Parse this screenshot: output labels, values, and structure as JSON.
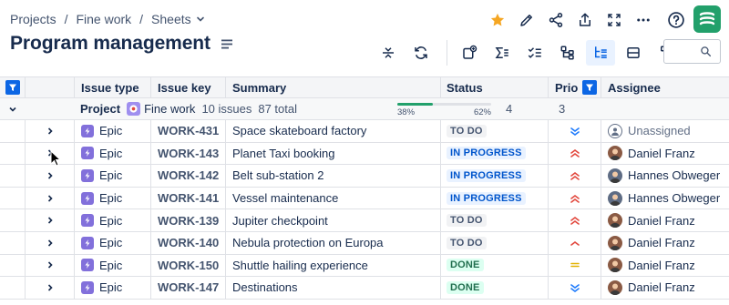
{
  "breadcrumb": {
    "items": [
      "Projects",
      "Fine work",
      "Sheets"
    ]
  },
  "page_title": "Program management",
  "search": {
    "value": "",
    "placeholder": ""
  },
  "columns": {
    "issue_type": "Issue type",
    "issue_key": "Issue key",
    "summary": "Summary",
    "status": "Status",
    "priority": "Prio",
    "assignee": "Assignee"
  },
  "group": {
    "label": "Project",
    "project_name": "Fine work",
    "issue_count": "10 issues",
    "total": "87 total",
    "progress_done": 38,
    "progress_left_label": "38%",
    "progress_right_label": "62%",
    "priority_count": "4",
    "assignee_count": "3"
  },
  "rows": [
    {
      "type": "Epic",
      "key": "WORK-431",
      "summary": "Space skateboard factory",
      "status": "TO DO",
      "status_kind": "todo",
      "priority": "low",
      "assignee": "Unassigned",
      "assignee_kind": "unassigned"
    },
    {
      "type": "Epic",
      "key": "WORK-143",
      "summary": "Planet Taxi booking",
      "status": "IN PROGRESS",
      "status_kind": "progress",
      "priority": "highest",
      "assignee": "Daniel Franz",
      "assignee_kind": "df"
    },
    {
      "type": "Epic",
      "key": "WORK-142",
      "summary": "Belt sub-station 2",
      "status": "IN PROGRESS",
      "status_kind": "progress",
      "priority": "highest",
      "assignee": "Hannes Obweger",
      "assignee_kind": "ho"
    },
    {
      "type": "Epic",
      "key": "WORK-141",
      "summary": "Vessel maintenance",
      "status": "IN PROGRESS",
      "status_kind": "progress",
      "priority": "highest",
      "assignee": "Hannes Obweger",
      "assignee_kind": "ho"
    },
    {
      "type": "Epic",
      "key": "WORK-139",
      "summary": "Jupiter checkpoint",
      "status": "TO DO",
      "status_kind": "todo",
      "priority": "highest",
      "assignee": "Daniel Franz",
      "assignee_kind": "df"
    },
    {
      "type": "Epic",
      "key": "WORK-140",
      "summary": "Nebula protection on Europa",
      "status": "TO DO",
      "status_kind": "todo",
      "priority": "high",
      "assignee": "Daniel Franz",
      "assignee_kind": "df"
    },
    {
      "type": "Epic",
      "key": "WORK-150",
      "summary": "Shuttle hailing experience",
      "status": "DONE",
      "status_kind": "done",
      "priority": "medium",
      "assignee": "Daniel Franz",
      "assignee_kind": "df"
    },
    {
      "type": "Epic",
      "key": "WORK-147",
      "summary": "Destinations",
      "status": "DONE",
      "status_kind": "done",
      "priority": "low",
      "assignee": "Daniel Franz",
      "assignee_kind": "df"
    }
  ],
  "colors": {
    "accent": "#0c66e4",
    "star": "#f5a623",
    "logo": "#22a06b",
    "epic": "#8270db",
    "prio_high": "#e2483d",
    "prio_medium": "#e2b203",
    "prio_low": "#1d7afc"
  }
}
